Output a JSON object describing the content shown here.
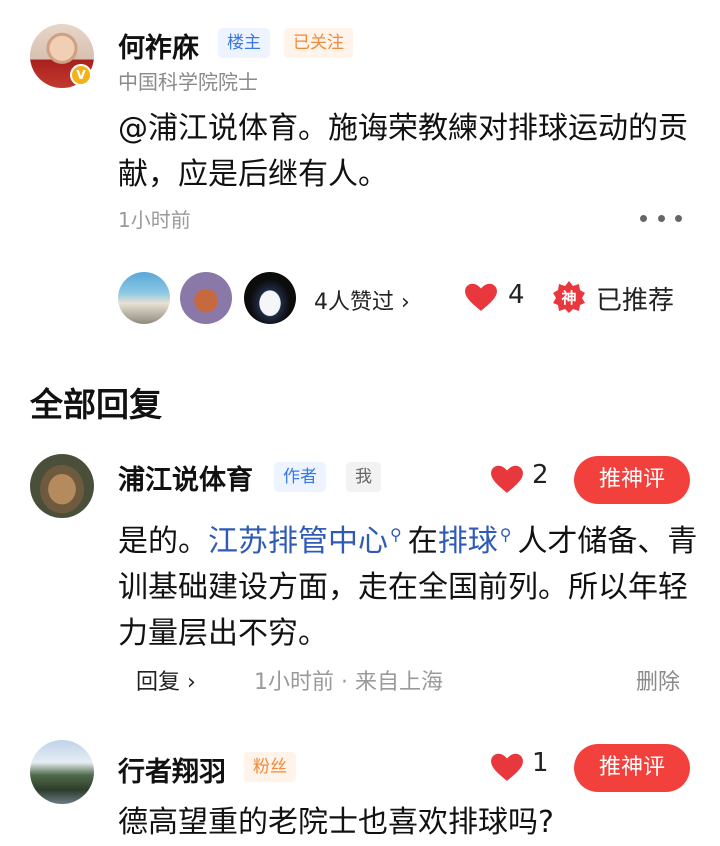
{
  "post": {
    "author_name": "何祚庥",
    "tags": {
      "owner": "楼主",
      "followed": "已关注"
    },
    "author_title": "中国科学院院士",
    "text": "@浦江说体育。施诲荣教練对排球运动的贡献，应是后继有人。",
    "time": "1小时前",
    "likers_summary": "4人赞过 ›",
    "like_count": "4",
    "shen_icon_char": "神",
    "recommended_label": "已推荐",
    "verified_mark": "V"
  },
  "replies_section": {
    "title": "全部回复"
  },
  "replies": [
    {
      "author_name": "浦江说体育",
      "tag_author": "作者",
      "tag_me": "我",
      "like_count": "2",
      "push_label": "推神评",
      "text_parts": {
        "pre": "是的。",
        "link1": "江苏排管中心",
        "mid": "在",
        "link2": "排球",
        "post": "人才储备、青训基础建设方面，走在全国前列。所以年轻力量层出不穷。"
      },
      "reply_label": "回复 ›",
      "meta": "1小时前 · 来自上海",
      "delete_label": "删除"
    },
    {
      "author_name": "行者翔羽",
      "tag_fan": "粉丝",
      "like_count": "1",
      "push_label": "推神评",
      "text": "德高望重的老院士也喜欢排球吗?"
    }
  ],
  "colors": {
    "accent_red": "#f2403c",
    "link_blue": "#2f5bb5",
    "heart_red": "#e8383d"
  }
}
